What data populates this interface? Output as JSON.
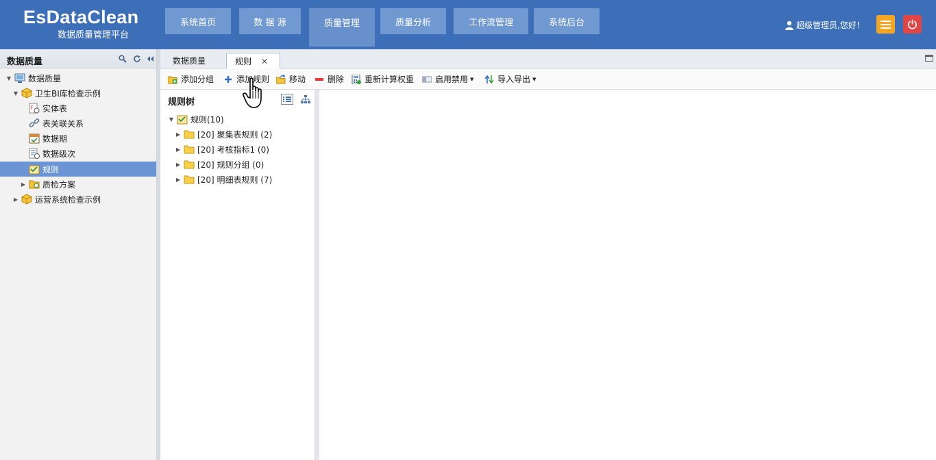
{
  "app": {
    "title": "EsDataClean",
    "subtitle": "数据质量管理平台"
  },
  "nav": [
    {
      "label": "系统首页",
      "active": false
    },
    {
      "label": "数 据 源",
      "active": false
    },
    {
      "label": "质量管理",
      "active": true
    },
    {
      "label": "质量分析",
      "active": false
    },
    {
      "label": "工作流管理",
      "active": false
    },
    {
      "label": "系统后台",
      "active": false
    }
  ],
  "user": {
    "greeting": "超级管理员,您好！"
  },
  "left_panel": {
    "title": "数据质量",
    "tree": [
      {
        "label": "数据质量",
        "icon": "monitor-icon",
        "expanded": true
      },
      {
        "label": "卫生BI库检查示例",
        "icon": "cube-icon",
        "expanded": true
      },
      {
        "label": "实体表",
        "icon": "entity-table-icon"
      },
      {
        "label": "表关联关系",
        "icon": "link-icon"
      },
      {
        "label": "数据期",
        "icon": "calendar-icon"
      },
      {
        "label": "数据级次",
        "icon": "level-icon"
      },
      {
        "label": "规则",
        "icon": "rule-icon",
        "selected": true
      },
      {
        "label": "质检方案",
        "icon": "plan-icon",
        "expanded": false
      },
      {
        "label": "运营系统检查示例",
        "icon": "cube-icon",
        "expanded": false
      }
    ]
  },
  "tabs": [
    {
      "label": "数据质量"
    },
    {
      "label": "规则",
      "active": true,
      "close": "✕"
    }
  ],
  "toolbar": {
    "add_group": "添加分组",
    "add_rule": "添加规则",
    "move": "移动",
    "delete": "删除",
    "recalc": "重新计算权重",
    "enable_disable": "启用禁用",
    "import_export": "导入导出"
  },
  "rule_tree": {
    "title": "规则树",
    "root": "规则(10)",
    "items": [
      "[20] 聚集表规则 (2)",
      "[20] 考核指标1 (0)",
      "[20] 规则分组 (0)",
      "[20] 明细表规则 (7)"
    ]
  },
  "colors": {
    "header": "#3d6fb8",
    "nav": "#7199d1",
    "selected": "#6a94d4",
    "menu_btn": "#f5a623",
    "power_btn": "#e04646"
  }
}
